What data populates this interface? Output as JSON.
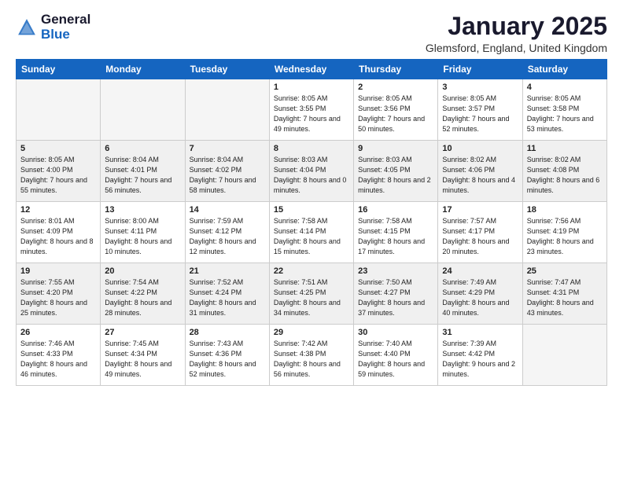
{
  "header": {
    "logo_general": "General",
    "logo_blue": "Blue",
    "month_year": "January 2025",
    "location": "Glemsford, England, United Kingdom"
  },
  "days_of_week": [
    "Sunday",
    "Monday",
    "Tuesday",
    "Wednesday",
    "Thursday",
    "Friday",
    "Saturday"
  ],
  "weeks": [
    [
      {
        "day": "",
        "empty": true
      },
      {
        "day": "",
        "empty": true
      },
      {
        "day": "",
        "empty": true
      },
      {
        "day": "1",
        "sunrise": "Sunrise: 8:05 AM",
        "sunset": "Sunset: 3:55 PM",
        "daylight": "Daylight: 7 hours and 49 minutes."
      },
      {
        "day": "2",
        "sunrise": "Sunrise: 8:05 AM",
        "sunset": "Sunset: 3:56 PM",
        "daylight": "Daylight: 7 hours and 50 minutes."
      },
      {
        "day": "3",
        "sunrise": "Sunrise: 8:05 AM",
        "sunset": "Sunset: 3:57 PM",
        "daylight": "Daylight: 7 hours and 52 minutes."
      },
      {
        "day": "4",
        "sunrise": "Sunrise: 8:05 AM",
        "sunset": "Sunset: 3:58 PM",
        "daylight": "Daylight: 7 hours and 53 minutes."
      }
    ],
    [
      {
        "day": "5",
        "sunrise": "Sunrise: 8:05 AM",
        "sunset": "Sunset: 4:00 PM",
        "daylight": "Daylight: 7 hours and 55 minutes."
      },
      {
        "day": "6",
        "sunrise": "Sunrise: 8:04 AM",
        "sunset": "Sunset: 4:01 PM",
        "daylight": "Daylight: 7 hours and 56 minutes."
      },
      {
        "day": "7",
        "sunrise": "Sunrise: 8:04 AM",
        "sunset": "Sunset: 4:02 PM",
        "daylight": "Daylight: 7 hours and 58 minutes."
      },
      {
        "day": "8",
        "sunrise": "Sunrise: 8:03 AM",
        "sunset": "Sunset: 4:04 PM",
        "daylight": "Daylight: 8 hours and 0 minutes."
      },
      {
        "day": "9",
        "sunrise": "Sunrise: 8:03 AM",
        "sunset": "Sunset: 4:05 PM",
        "daylight": "Daylight: 8 hours and 2 minutes."
      },
      {
        "day": "10",
        "sunrise": "Sunrise: 8:02 AM",
        "sunset": "Sunset: 4:06 PM",
        "daylight": "Daylight: 8 hours and 4 minutes."
      },
      {
        "day": "11",
        "sunrise": "Sunrise: 8:02 AM",
        "sunset": "Sunset: 4:08 PM",
        "daylight": "Daylight: 8 hours and 6 minutes."
      }
    ],
    [
      {
        "day": "12",
        "sunrise": "Sunrise: 8:01 AM",
        "sunset": "Sunset: 4:09 PM",
        "daylight": "Daylight: 8 hours and 8 minutes."
      },
      {
        "day": "13",
        "sunrise": "Sunrise: 8:00 AM",
        "sunset": "Sunset: 4:11 PM",
        "daylight": "Daylight: 8 hours and 10 minutes."
      },
      {
        "day": "14",
        "sunrise": "Sunrise: 7:59 AM",
        "sunset": "Sunset: 4:12 PM",
        "daylight": "Daylight: 8 hours and 12 minutes."
      },
      {
        "day": "15",
        "sunrise": "Sunrise: 7:58 AM",
        "sunset": "Sunset: 4:14 PM",
        "daylight": "Daylight: 8 hours and 15 minutes."
      },
      {
        "day": "16",
        "sunrise": "Sunrise: 7:58 AM",
        "sunset": "Sunset: 4:15 PM",
        "daylight": "Daylight: 8 hours and 17 minutes."
      },
      {
        "day": "17",
        "sunrise": "Sunrise: 7:57 AM",
        "sunset": "Sunset: 4:17 PM",
        "daylight": "Daylight: 8 hours and 20 minutes."
      },
      {
        "day": "18",
        "sunrise": "Sunrise: 7:56 AM",
        "sunset": "Sunset: 4:19 PM",
        "daylight": "Daylight: 8 hours and 23 minutes."
      }
    ],
    [
      {
        "day": "19",
        "sunrise": "Sunrise: 7:55 AM",
        "sunset": "Sunset: 4:20 PM",
        "daylight": "Daylight: 8 hours and 25 minutes."
      },
      {
        "day": "20",
        "sunrise": "Sunrise: 7:54 AM",
        "sunset": "Sunset: 4:22 PM",
        "daylight": "Daylight: 8 hours and 28 minutes."
      },
      {
        "day": "21",
        "sunrise": "Sunrise: 7:52 AM",
        "sunset": "Sunset: 4:24 PM",
        "daylight": "Daylight: 8 hours and 31 minutes."
      },
      {
        "day": "22",
        "sunrise": "Sunrise: 7:51 AM",
        "sunset": "Sunset: 4:25 PM",
        "daylight": "Daylight: 8 hours and 34 minutes."
      },
      {
        "day": "23",
        "sunrise": "Sunrise: 7:50 AM",
        "sunset": "Sunset: 4:27 PM",
        "daylight": "Daylight: 8 hours and 37 minutes."
      },
      {
        "day": "24",
        "sunrise": "Sunrise: 7:49 AM",
        "sunset": "Sunset: 4:29 PM",
        "daylight": "Daylight: 8 hours and 40 minutes."
      },
      {
        "day": "25",
        "sunrise": "Sunrise: 7:47 AM",
        "sunset": "Sunset: 4:31 PM",
        "daylight": "Daylight: 8 hours and 43 minutes."
      }
    ],
    [
      {
        "day": "26",
        "sunrise": "Sunrise: 7:46 AM",
        "sunset": "Sunset: 4:33 PM",
        "daylight": "Daylight: 8 hours and 46 minutes."
      },
      {
        "day": "27",
        "sunrise": "Sunrise: 7:45 AM",
        "sunset": "Sunset: 4:34 PM",
        "daylight": "Daylight: 8 hours and 49 minutes."
      },
      {
        "day": "28",
        "sunrise": "Sunrise: 7:43 AM",
        "sunset": "Sunset: 4:36 PM",
        "daylight": "Daylight: 8 hours and 52 minutes."
      },
      {
        "day": "29",
        "sunrise": "Sunrise: 7:42 AM",
        "sunset": "Sunset: 4:38 PM",
        "daylight": "Daylight: 8 hours and 56 minutes."
      },
      {
        "day": "30",
        "sunrise": "Sunrise: 7:40 AM",
        "sunset": "Sunset: 4:40 PM",
        "daylight": "Daylight: 8 hours and 59 minutes."
      },
      {
        "day": "31",
        "sunrise": "Sunrise: 7:39 AM",
        "sunset": "Sunset: 4:42 PM",
        "daylight": "Daylight: 9 hours and 2 minutes."
      },
      {
        "day": "",
        "empty": true
      }
    ]
  ]
}
